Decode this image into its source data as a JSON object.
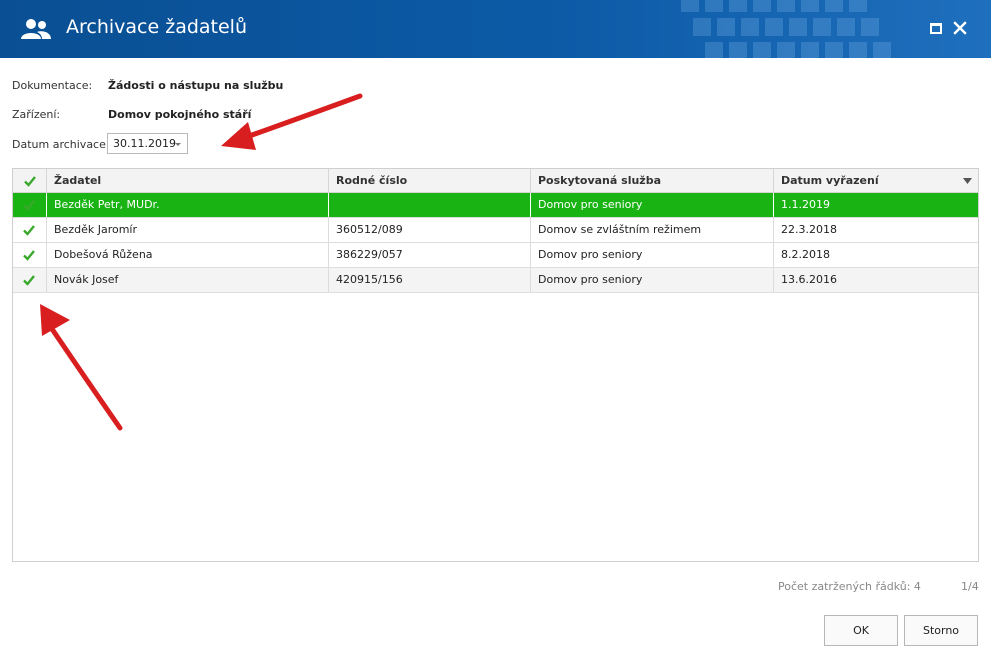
{
  "window": {
    "title": "Archivace žadatelů",
    "app_icon": "users-icon",
    "controls": [
      "maximize-icon",
      "close-icon"
    ]
  },
  "form": {
    "documentation_label": "Dokumentace:",
    "documentation_value": "Žádosti o nástupu na službu",
    "facility_label": "Zařízení:",
    "facility_value": "Domov pokojného stáří",
    "archive_date_label": "Datum archivace:",
    "archive_date_value": "30.11.2019"
  },
  "grid": {
    "columns": [
      "Žadatel",
      "Rodné číslo",
      "Poskytovaná služba",
      "Datum vyřazení"
    ],
    "header_check_icon": "checkmark-icon",
    "sort_icon": "sort-down-icon",
    "rows": [
      {
        "applicant": "Bezděk Petr, MUDr.",
        "birth_number": "",
        "service": "Domov pro seniory",
        "date": "1.1.2019",
        "checked": true,
        "selected": true
      },
      {
        "applicant": "Bezděk Jaromír",
        "birth_number": "360512/089",
        "service": "Domov se zvláštním režimem",
        "date": "22.3.2018",
        "checked": true,
        "selected": false
      },
      {
        "applicant": "Dobešová Růžena",
        "birth_number": "386229/057",
        "service": "Domov pro seniory",
        "date": "8.2.2018",
        "checked": true,
        "selected": false
      },
      {
        "applicant": "Novák Josef",
        "birth_number": "420915/156",
        "service": "Domov pro seniory",
        "date": "13.6.2016",
        "checked": true,
        "selected": false
      }
    ]
  },
  "status": {
    "checked_count": "Počet zatržených řádků: 4",
    "page": "1/4"
  },
  "buttons": {
    "ok": "OK",
    "cancel": "Storno"
  },
  "colors": {
    "titlebar": "#0c5aa6",
    "selected_row": "#19b314",
    "check": "#3aa82b",
    "annotation_arrow": "#d81e1e"
  }
}
